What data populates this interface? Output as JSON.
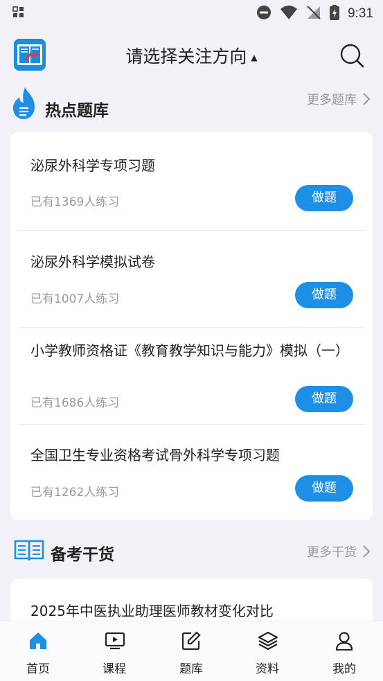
{
  "status": {
    "time": "9:31"
  },
  "header": {
    "title": "请选择关注方向",
    "caret": "▲"
  },
  "hot": {
    "title": "热点题库",
    "more": "更多题库",
    "items": [
      {
        "title": "泌尿外科学专项习题",
        "sub": "已有1369人练习",
        "action": "做题"
      },
      {
        "title": "泌尿外科学模拟试卷",
        "sub": "已有1007人练习",
        "action": "做题"
      },
      {
        "title": "小学教师资格证《教育教学知识与能力》模拟（一）",
        "sub": "已有1686人练习",
        "action": "做题"
      },
      {
        "title": "全国卫生专业资格考试骨外科学专项习题",
        "sub": "已有1262人练习",
        "action": "做题"
      }
    ]
  },
  "prep": {
    "title": "备考干货",
    "more": "更多干货",
    "items": [
      {
        "title": "2025年中医执业助理医师教材变化对比"
      }
    ]
  },
  "tabs": [
    {
      "label": "首页",
      "active": true
    },
    {
      "label": "课程",
      "active": false
    },
    {
      "label": "题库",
      "active": false
    },
    {
      "label": "资料",
      "active": false
    },
    {
      "label": "我的",
      "active": false
    }
  ],
  "colors": {
    "accent": "#1e8fe6",
    "muted": "#999999"
  }
}
